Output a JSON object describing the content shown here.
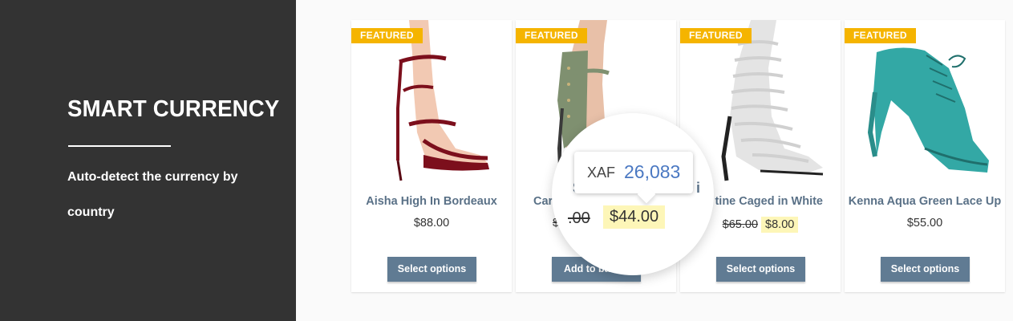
{
  "banner": {
    "title": "SMART CURRENCY",
    "subtitle": "Auto-detect the currency by country"
  },
  "products": [
    {
      "badge": "FEATURED",
      "name": "Aisha High In Bordeaux",
      "price": "$88.00",
      "old_price": "",
      "sale_price": "",
      "button": "Select options",
      "image": "heel-bordeaux"
    },
    {
      "badge": "FEATURED",
      "name": "Car",
      "price": "",
      "old_price": "$",
      "sale_price": "",
      "button": "Add to bas",
      "image": "heel-khaki"
    },
    {
      "badge": "FEATURED",
      "name": "tine Caged in White",
      "price": "",
      "old_price": "$65.00",
      "sale_price": "$8.00",
      "button": "Select options",
      "image": "heel-white-caged"
    },
    {
      "badge": "FEATURED",
      "name": "Kenna Aqua Green Lace Up",
      "price": "$55.00",
      "old_price": "",
      "sale_price": "",
      "button": "Select options",
      "image": "heel-aqua-lace"
    }
  ],
  "magnifier": {
    "tooltip_currency": "XAF",
    "tooltip_value": "26,083",
    "old_price": ".00",
    "sale_price": "$44.00",
    "name_fragment_left": "S",
    "name_fragment_right": "i"
  },
  "colors": {
    "banner_bg": "#333333",
    "badge": "#f5b400",
    "button": "#607b93",
    "sale_highlight": "#fdf6b8",
    "product_name": "#5a7187",
    "tooltip_value": "#4a78c2"
  }
}
